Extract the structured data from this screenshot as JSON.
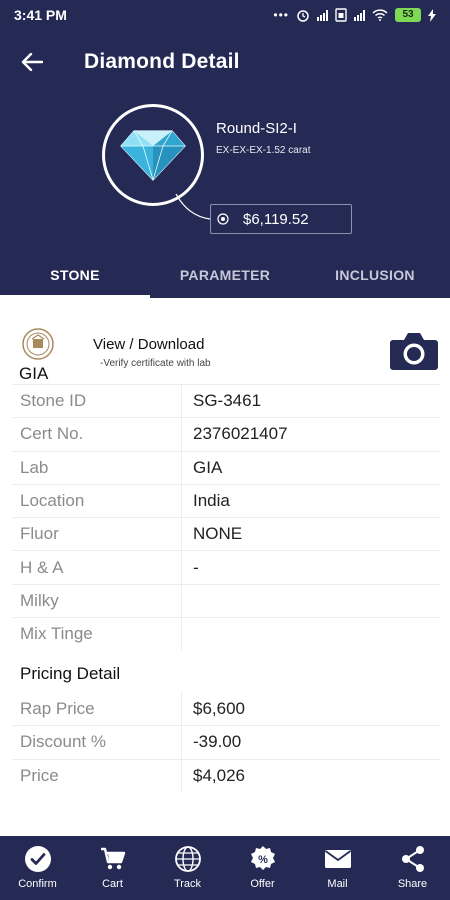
{
  "status_bar": {
    "time": "3:41 PM",
    "battery": "53"
  },
  "app_bar": {
    "title": "Diamond Detail"
  },
  "hero": {
    "shape_name": "Round-SI2-I",
    "spec": "EX-EX-EX-1.52 carat",
    "price": "$6,119.52"
  },
  "tabs": [
    {
      "label": "STONE",
      "active": true
    },
    {
      "label": "PARAMETER",
      "active": false
    },
    {
      "label": "INCLUSION",
      "active": false
    }
  ],
  "certificate": {
    "lab_name": "GIA",
    "view_label": "View / Download",
    "verify_note": "-Verify certificate with lab"
  },
  "details": [
    {
      "label": "Stone ID",
      "value": "SG-3461"
    },
    {
      "label": "Cert No.",
      "value": "2376021407"
    },
    {
      "label": "Lab",
      "value": "GIA"
    },
    {
      "label": "Location",
      "value": "India"
    },
    {
      "label": "Fluor",
      "value": "NONE"
    },
    {
      "label": "H & A",
      "value": "-"
    },
    {
      "label": "Milky",
      "value": ""
    },
    {
      "label": "Mix Tinge",
      "value": ""
    }
  ],
  "pricing": {
    "title": "Pricing Detail",
    "rows": [
      {
        "label": "Rap Price",
        "value": "$6,600"
      },
      {
        "label": "Discount %",
        "value": "-39.00"
      },
      {
        "label": "Price",
        "value": "$4,026"
      }
    ]
  },
  "bottom_nav": [
    {
      "label": "Confirm",
      "icon": "check-circle-icon"
    },
    {
      "label": "Cart",
      "icon": "cart-icon"
    },
    {
      "label": "Track",
      "icon": "globe-icon"
    },
    {
      "label": "Offer",
      "icon": "offer-badge-icon"
    },
    {
      "label": "Mail",
      "icon": "mail-icon"
    },
    {
      "label": "Share",
      "icon": "share-icon"
    }
  ],
  "colors": {
    "primary": "#252a55",
    "label_text": "#8b8b8b",
    "divider": "#ececec"
  }
}
